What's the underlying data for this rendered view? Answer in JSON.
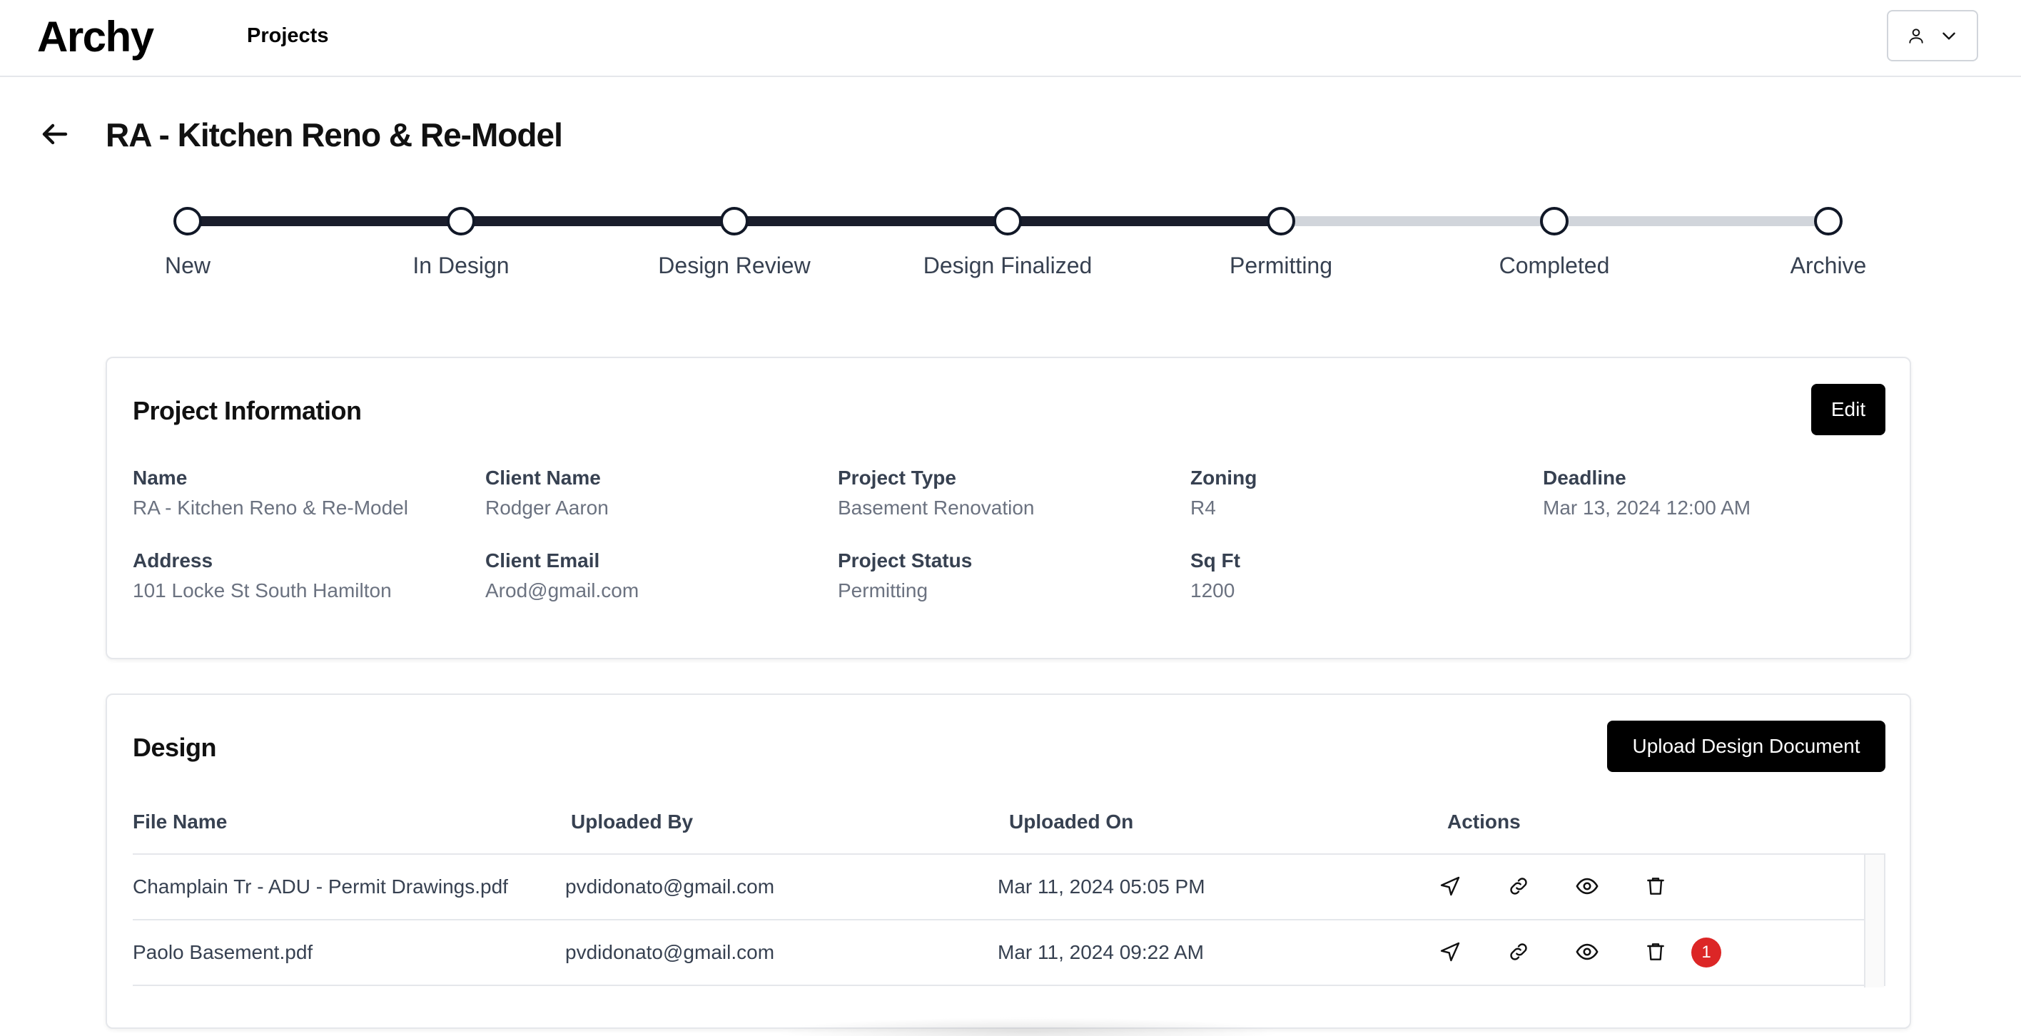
{
  "app": {
    "logo": "Archy",
    "nav_projects": "Projects"
  },
  "header": {
    "user_icon": "user-icon",
    "chevron_icon": "chevron-down-icon"
  },
  "page": {
    "title": "RA - Kitchen Reno & Re-Model",
    "back_icon": "arrow-left-icon"
  },
  "stepper": {
    "steps": [
      "New",
      "In Design",
      "Design Review",
      "Design Finalized",
      "Permitting",
      "Completed",
      "Archive"
    ],
    "current_step": "Permitting",
    "completed_color": "#1a1d2b",
    "pending_color": "#d1d5db"
  },
  "project_info": {
    "title": "Project Information",
    "edit_label": "Edit",
    "fields": [
      {
        "label": "Name",
        "value": "RA - Kitchen Reno & Re-Model"
      },
      {
        "label": "Client Name",
        "value": "Rodger Aaron"
      },
      {
        "label": "Project Type",
        "value": "Basement Renovation"
      },
      {
        "label": "Zoning",
        "value": "R4"
      },
      {
        "label": "Deadline",
        "value": "Mar 13, 2024 12:00 AM"
      },
      {
        "label": "Address",
        "value": "101 Locke St South Hamilton"
      },
      {
        "label": "Client Email",
        "value": "Arod@gmail.com"
      },
      {
        "label": "Project Status",
        "value": "Permitting"
      },
      {
        "label": "Sq Ft",
        "value": "1200"
      }
    ]
  },
  "design": {
    "title": "Design",
    "upload_label": "Upload Design Document",
    "columns": [
      "File Name",
      "Uploaded By",
      "Uploaded On",
      "Actions"
    ],
    "rows": [
      {
        "file": "Champlain Tr - ADU - Permit Drawings.pdf",
        "by": "pvdidonato@gmail.com",
        "on": "Mar 11, 2024 05:05 PM",
        "badge": ""
      },
      {
        "file": "Paolo Basement.pdf",
        "by": "pvdidonato@gmail.com",
        "on": "Mar 11, 2024 09:22 AM",
        "badge": "1"
      }
    ],
    "action_icons": [
      "send-icon",
      "link-icon",
      "eye-icon",
      "trash-icon"
    ],
    "badge_color": "#dc2626"
  }
}
